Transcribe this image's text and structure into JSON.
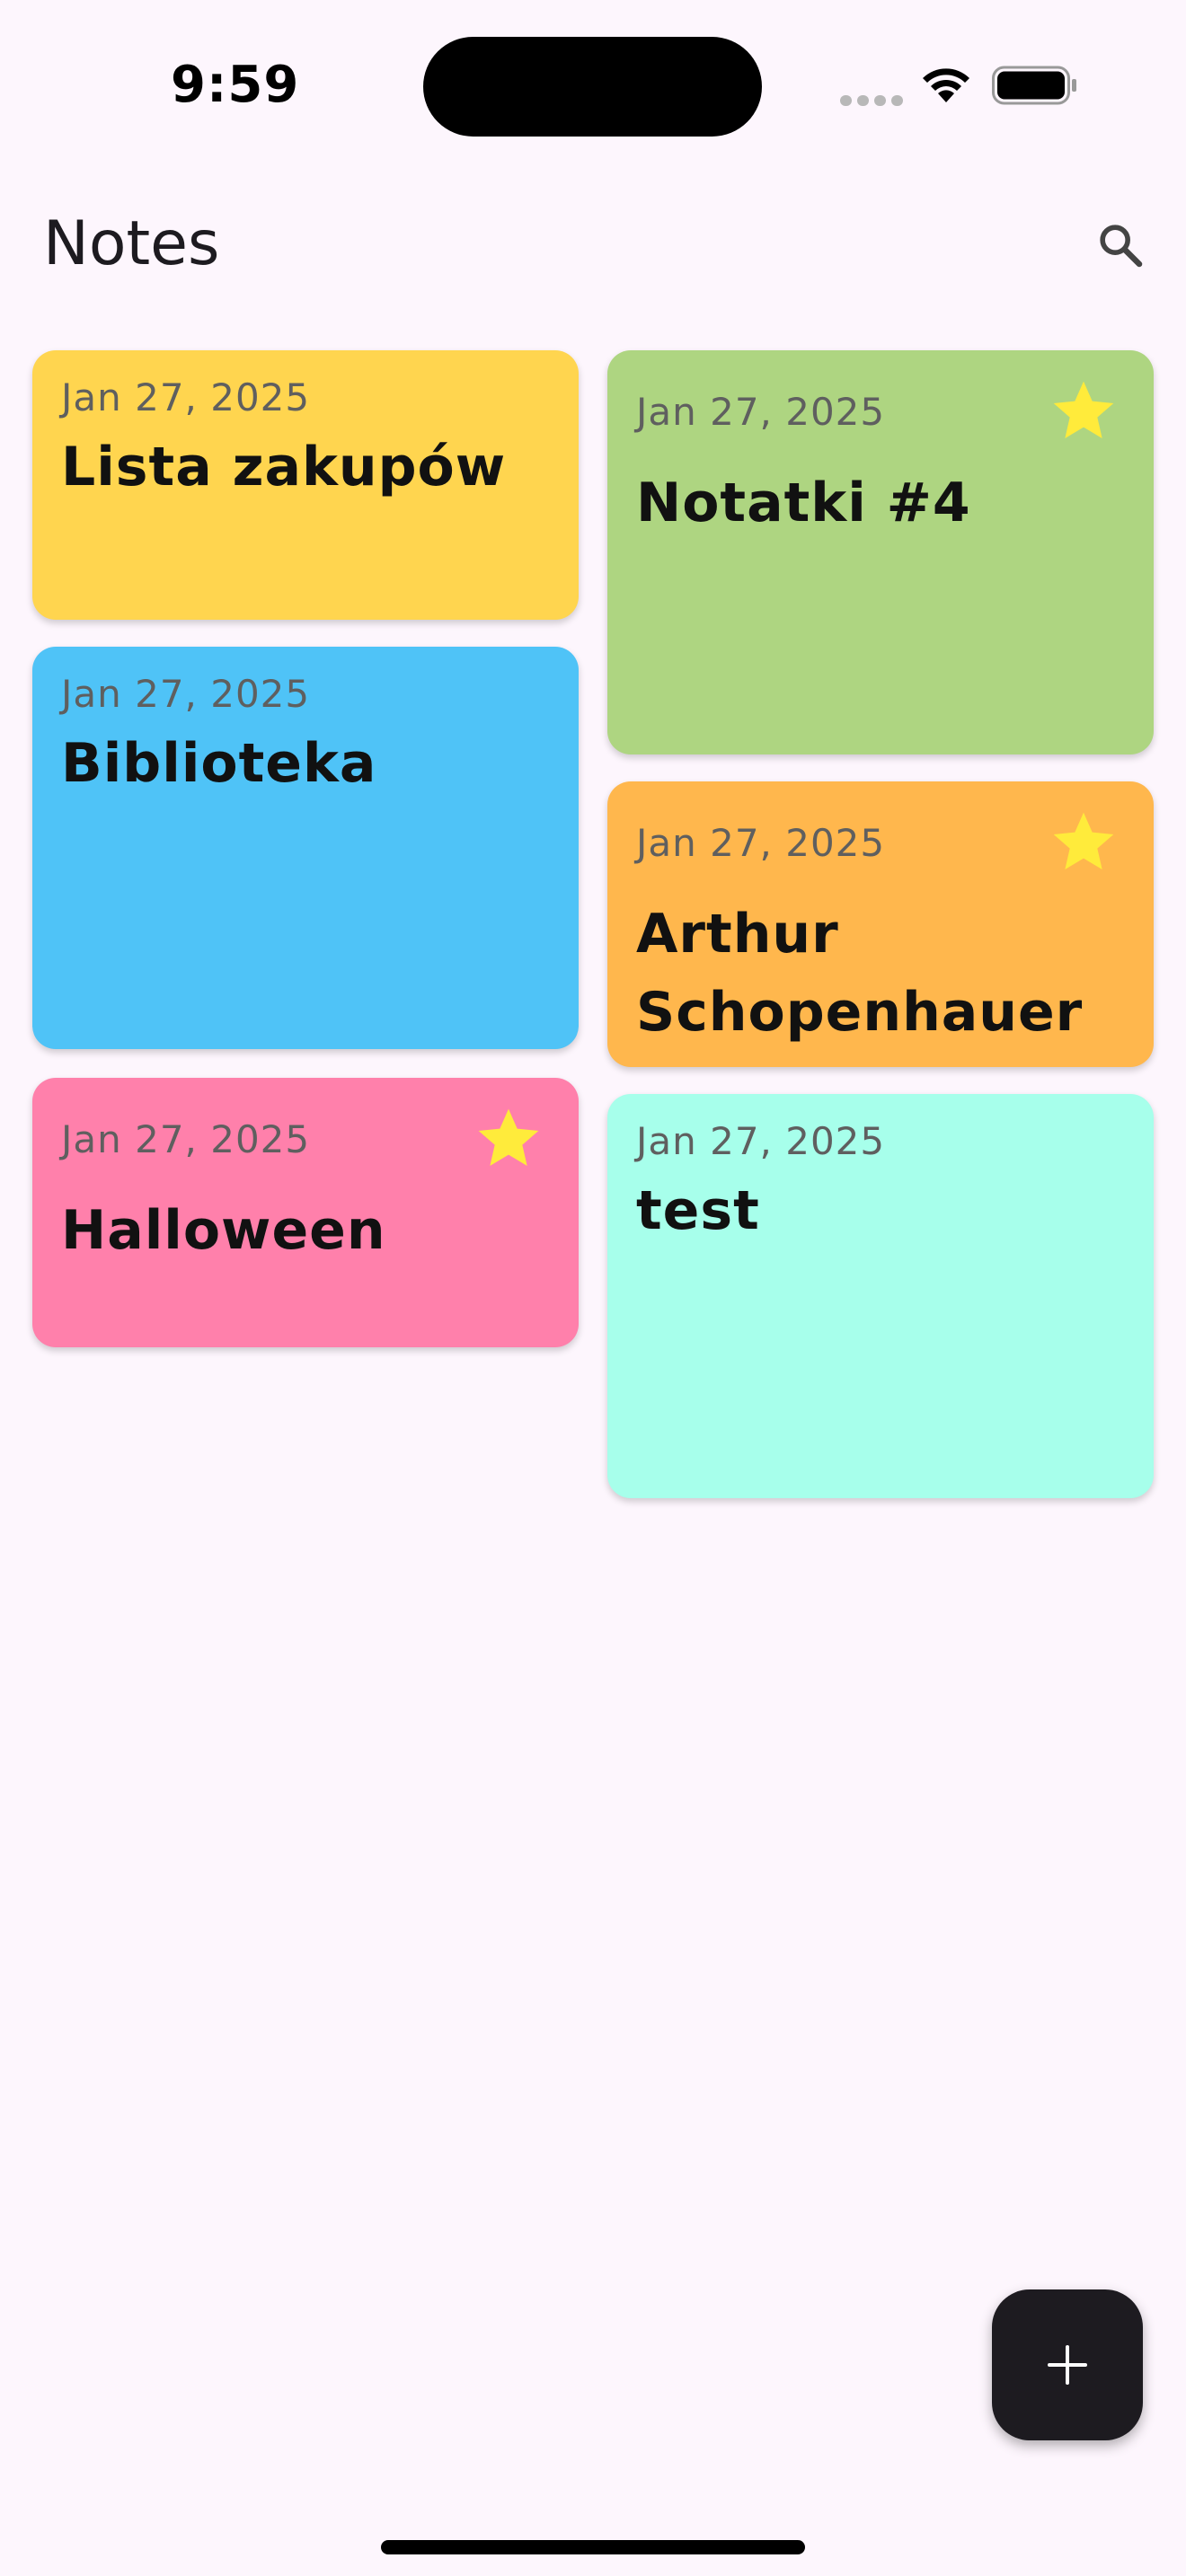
{
  "status_bar": {
    "time": "9:59"
  },
  "app_bar": {
    "title": "Notes",
    "search_icon": "search-icon"
  },
  "notes": [
    {
      "date": "Jan 27, 2025",
      "title": "Lista zakupów",
      "color": "#FFD54F",
      "starred": false
    },
    {
      "date": "Jan 27, 2025",
      "title": "Biblioteka",
      "color": "#4FC3F7",
      "starred": false
    },
    {
      "date": "Jan 27, 2025",
      "title": "Halloween",
      "color": "#FF80AB",
      "starred": true
    },
    {
      "date": "Jan 27, 2025",
      "title": "Notatki #4",
      "color": "#AED581",
      "starred": true
    },
    {
      "date": "Jan 27, 2025",
      "title": "Arthur Schopenhauer",
      "color": "#FFB74D",
      "starred": true
    },
    {
      "date": "Jan 27, 2025",
      "title": "test",
      "color": "#A7FFEB",
      "starred": false
    }
  ],
  "fab": {
    "icon": "plus-icon"
  },
  "colors": {
    "background": "#FDF6FD",
    "star": "#FFEB3B",
    "fab": "#1D1B20"
  }
}
